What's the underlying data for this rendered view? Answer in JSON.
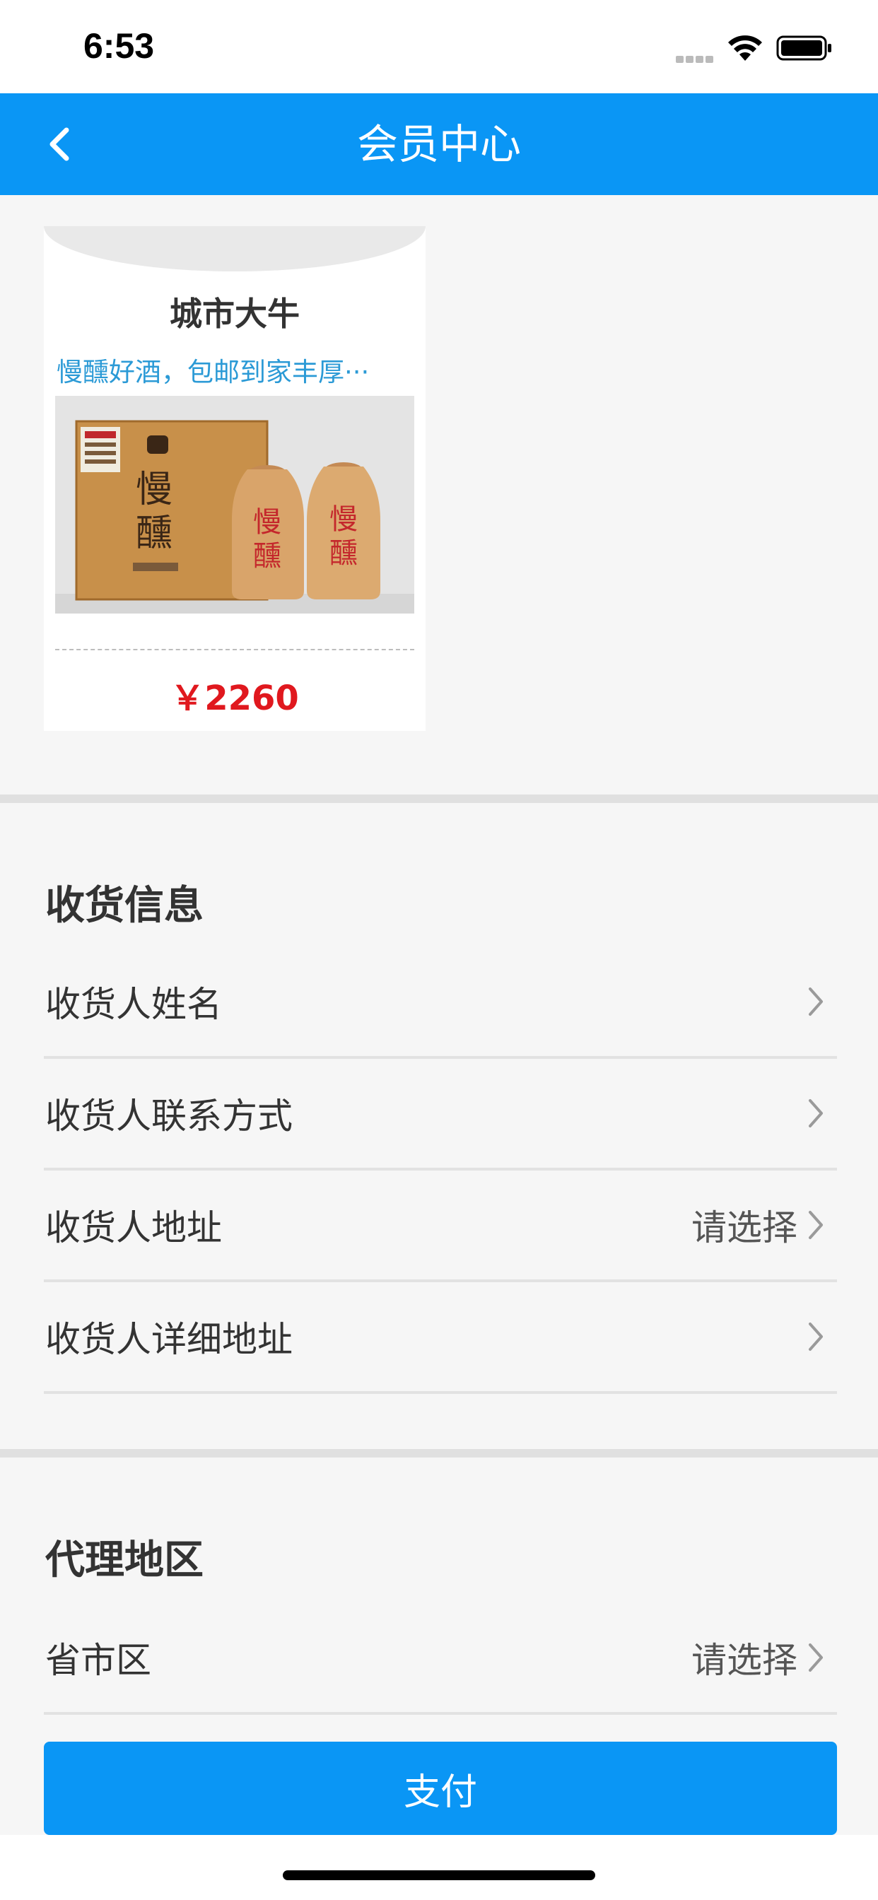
{
  "status_bar": {
    "time": "6:53",
    "icons": [
      "signal-icon",
      "wifi-icon",
      "battery-icon"
    ]
  },
  "nav": {
    "back_icon": "chevron-left-icon",
    "title": "会员中心",
    "background": "#0a96f5"
  },
  "product": {
    "name": "城市大牛",
    "description": "慢醺好酒，包邮到家丰厚···",
    "price": "￥2260",
    "image_brand_text": "慢醺",
    "price_color": "#e0181e",
    "description_color": "#2b9ad6"
  },
  "shipping": {
    "title": "收货信息",
    "rows": [
      {
        "label": "收货人姓名",
        "value": ""
      },
      {
        "label": "收货人联系方式",
        "value": ""
      },
      {
        "label": "收货人地址",
        "value": "请选择"
      },
      {
        "label": "收货人详细地址",
        "value": ""
      }
    ]
  },
  "agency": {
    "title": "代理地区",
    "rows": [
      {
        "label": "省市区",
        "value": "请选择"
      }
    ]
  },
  "pay_button": {
    "label": "支付",
    "color": "#0a96f5"
  }
}
